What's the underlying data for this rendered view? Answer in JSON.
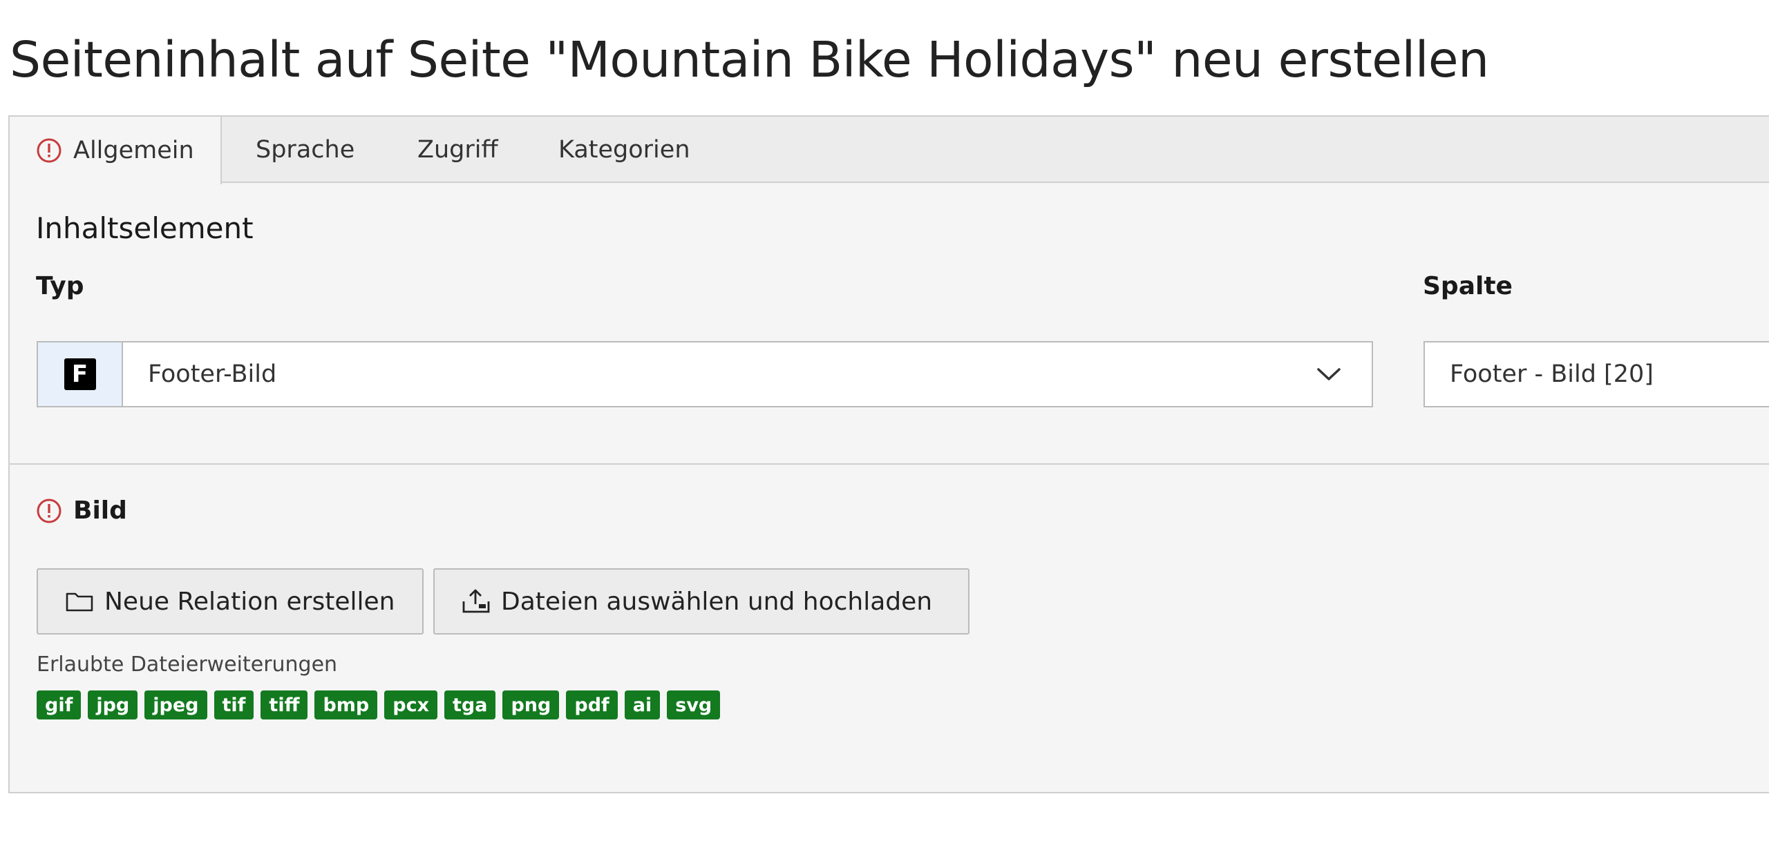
{
  "page": {
    "title": "Seiteninhalt auf Seite \"Mountain Bike Holidays\" neu erstellen"
  },
  "tabs": [
    {
      "label": "Allgemein",
      "active": true,
      "has_error": true
    },
    {
      "label": "Sprache",
      "active": false
    },
    {
      "label": "Zugriff",
      "active": false
    },
    {
      "label": "Kategorien",
      "active": false
    }
  ],
  "general": {
    "section_heading": "Inhaltselement",
    "type_field": {
      "label": "Typ",
      "icon_letter": "F",
      "value": "Footer-Bild"
    },
    "column_field": {
      "label": "Spalte",
      "value": "Footer - Bild [20]"
    }
  },
  "image": {
    "label": "Bild",
    "has_error": true,
    "new_relation_button": "Neue Relation erstellen",
    "upload_button": "Dateien auswählen und hochladen",
    "allowed_extensions_label": "Erlaubte Dateierweiterungen",
    "allowed_extensions": [
      "gif",
      "jpg",
      "jpeg",
      "tif",
      "tiff",
      "bmp",
      "pcx",
      "tga",
      "png",
      "pdf",
      "ai",
      "svg"
    ]
  },
  "colors": {
    "error": "#c83c3c",
    "badge_green": "#137a1f",
    "select_icon_bg": "#e8f1fb"
  },
  "icons": {
    "error": "exclamation-circle-icon",
    "select_type": "content-type-icon",
    "chevron": "chevron-down-icon",
    "folder": "folder-icon",
    "upload": "upload-icon"
  }
}
